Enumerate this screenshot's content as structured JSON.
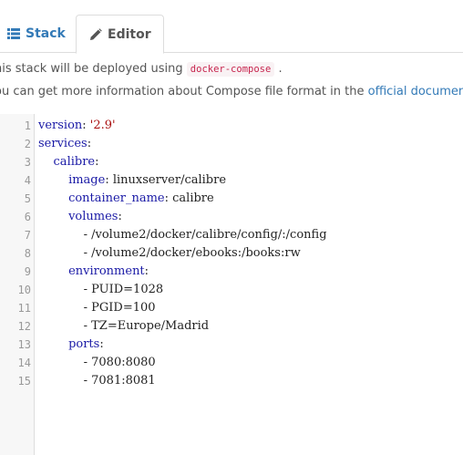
{
  "tabs": {
    "stack_label": "Stack",
    "editor_label": "Editor"
  },
  "info": {
    "line1_prefix": "his stack will be deployed using",
    "line1_code": "docker-compose",
    "line1_suffix": ".",
    "line2_prefix": "ou can get more information about Compose file format in the",
    "line2_link": "official documentation"
  },
  "editor": {
    "lines": [
      {
        "num": "1",
        "indent": "",
        "key": "version",
        "sep": ": ",
        "val": "'2.9'",
        "type": "kv-string"
      },
      {
        "num": "2",
        "indent": "",
        "key": "services",
        "sep": ":",
        "val": "",
        "type": "key"
      },
      {
        "num": "3",
        "indent": "    ",
        "key": "calibre",
        "sep": ":",
        "val": "",
        "type": "key"
      },
      {
        "num": "4",
        "indent": "        ",
        "key": "image",
        "sep": ": ",
        "val": "linuxserver/calibre",
        "type": "kv"
      },
      {
        "num": "5",
        "indent": "        ",
        "key": "container_name",
        "sep": ": ",
        "val": "calibre",
        "type": "kv"
      },
      {
        "num": "6",
        "indent": "        ",
        "key": "volumes",
        "sep": ":",
        "val": "",
        "type": "key"
      },
      {
        "num": "7",
        "indent": "            ",
        "key": "",
        "sep": "- ",
        "val": "/volume2/docker/calibre/config/:/config",
        "type": "item"
      },
      {
        "num": "8",
        "indent": "            ",
        "key": "",
        "sep": "- ",
        "val": "/volume2/docker/ebooks:/books:rw",
        "type": "item"
      },
      {
        "num": "9",
        "indent": "        ",
        "key": "environment",
        "sep": ":",
        "val": "",
        "type": "key"
      },
      {
        "num": "10",
        "indent": "            ",
        "key": "",
        "sep": "- ",
        "val": "PUID=1028",
        "type": "item"
      },
      {
        "num": "11",
        "indent": "            ",
        "key": "",
        "sep": "- ",
        "val": "PGID=100",
        "type": "item"
      },
      {
        "num": "12",
        "indent": "            ",
        "key": "",
        "sep": "- ",
        "val": "TZ=Europe/Madrid",
        "type": "item"
      },
      {
        "num": "13",
        "indent": "        ",
        "key": "ports",
        "sep": ":",
        "val": "",
        "type": "key"
      },
      {
        "num": "14",
        "indent": "            ",
        "key": "",
        "sep": "- ",
        "val": "7080:8080",
        "type": "item"
      },
      {
        "num": "15",
        "indent": "            ",
        "key": "",
        "sep": "- ",
        "val": "7081:8081",
        "type": "item"
      }
    ]
  },
  "icons": {
    "stack_icon": "list-icon",
    "editor_icon": "pencil-icon"
  },
  "colors": {
    "link": "#337ab7",
    "key": "#1a1aa6",
    "string": "#aa1111"
  }
}
